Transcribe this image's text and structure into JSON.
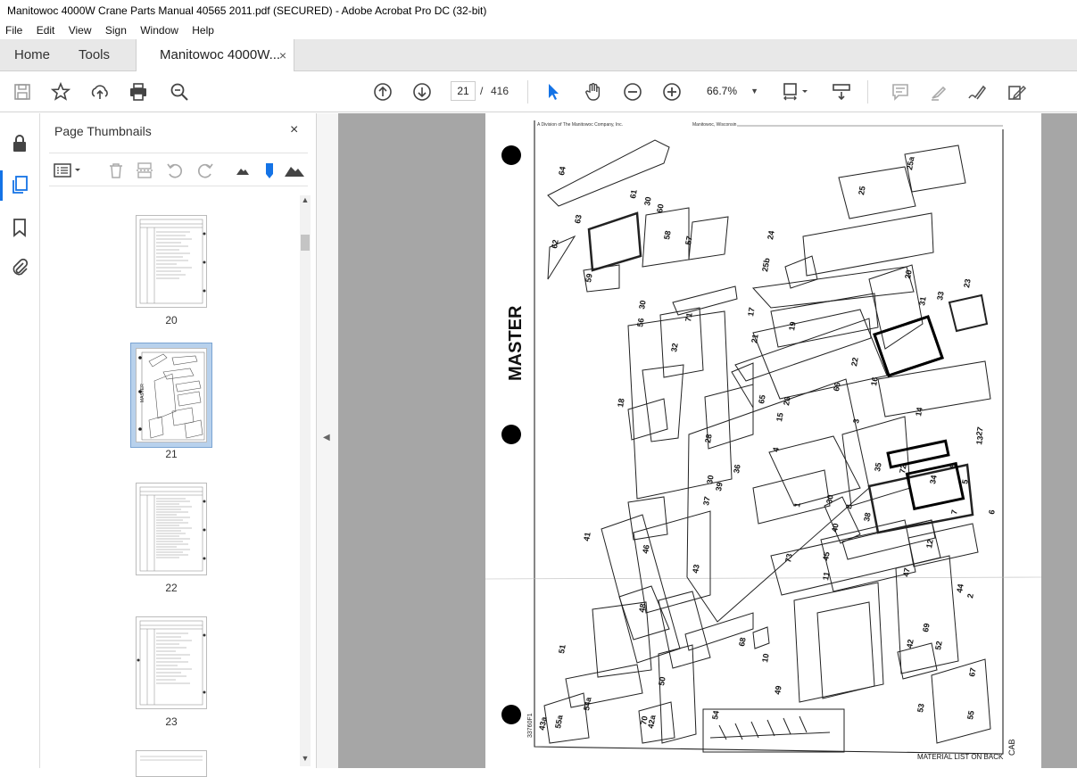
{
  "window": {
    "title": "Manitowoc 4000W Crane Parts Manual 40565 2011.pdf (SECURED) - Adobe Acrobat Pro DC (32-bit)"
  },
  "menu": [
    "File",
    "Edit",
    "View",
    "Sign",
    "Window",
    "Help"
  ],
  "tabs": {
    "home": "Home",
    "tools": "Tools",
    "document": "Manitowoc 4000W...",
    "close": "×"
  },
  "toolbar": {
    "current_page": "21",
    "separator": "/",
    "total_pages": "416",
    "zoom": "66.7%",
    "icons": [
      "save-icon",
      "star-icon",
      "upload-icon",
      "print-icon",
      "zoom-search-icon",
      "page-up-icon",
      "page-down-icon",
      "select-cursor-icon",
      "hand-icon",
      "zoom-out-icon",
      "zoom-in-icon",
      "zoom-dropdown-icon",
      "fit-page-icon",
      "scroll-mode-icon",
      "comment-icon",
      "highlight-icon",
      "sign-icon",
      "fill-sign-icon"
    ]
  },
  "sidebar": {
    "title": "Page Thumbnails",
    "close": "×",
    "thumbnails": [
      {
        "label": "20"
      },
      {
        "label": "21",
        "selected": true
      },
      {
        "label": "22"
      },
      {
        "label": "23"
      }
    ]
  },
  "document": {
    "header_left": "A Division of The Manitowoc Company, Inc.",
    "header_right": "Manitowoc, Wisconsin",
    "master": "MASTER",
    "footer": "MATERIAL LIST ON BACK",
    "side_label": "CAB",
    "drawing_no": "33760F1",
    "callouts": [
      "64",
      "61",
      "30",
      "60",
      "63",
      "62",
      "58",
      "57",
      "59",
      "24",
      "25",
      "25a",
      "25b",
      "20",
      "23",
      "33",
      "31",
      "30",
      "56",
      "71",
      "17",
      "19",
      "21",
      "22",
      "32",
      "16",
      "18",
      "65",
      "26",
      "15",
      "66",
      "4",
      "3",
      "14",
      "27",
      "28",
      "13",
      "9",
      "5",
      "72",
      "34",
      "35",
      "30",
      "36",
      "39",
      "30",
      "37",
      "8",
      "7",
      "6",
      "1",
      "38",
      "40",
      "41",
      "73",
      "45",
      "12",
      "46",
      "47",
      "43",
      "11",
      "44",
      "2",
      "48",
      "69",
      "68",
      "10",
      "42",
      "52",
      "51",
      "49",
      "67",
      "53",
      "50",
      "42a",
      "55a",
      "54a",
      "54",
      "55",
      "70",
      "43a"
    ]
  }
}
